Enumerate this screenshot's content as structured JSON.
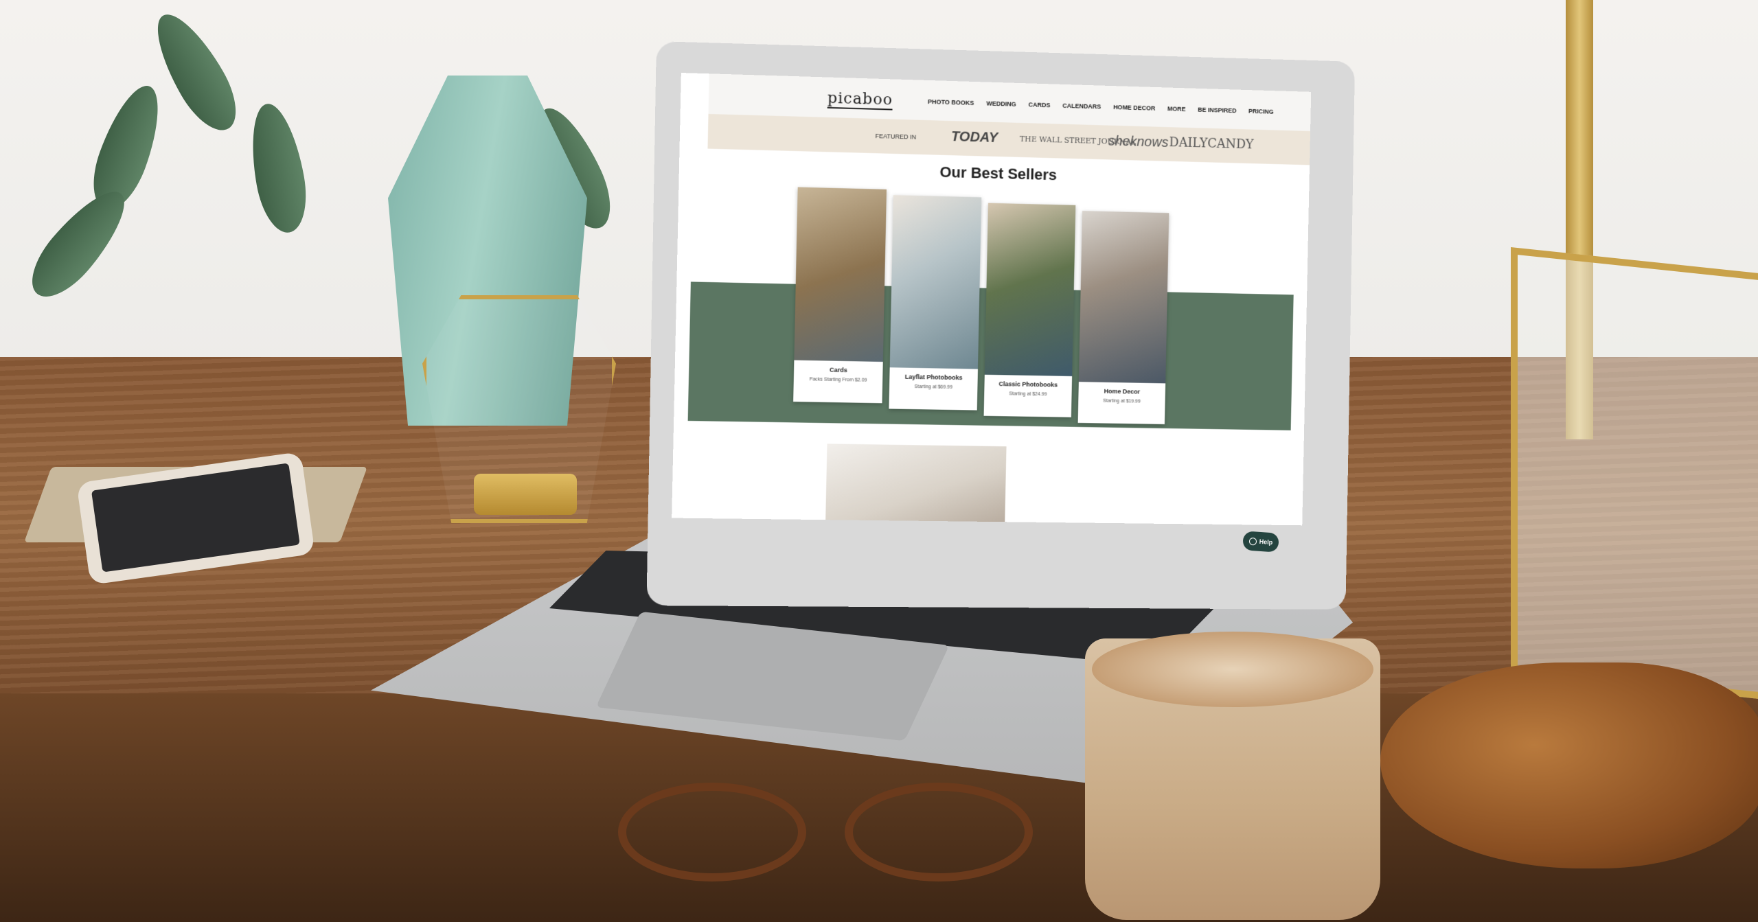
{
  "site": {
    "logo": "picaboo",
    "nav": [
      {
        "label": "PHOTO BOOKS"
      },
      {
        "label": "WEDDING"
      },
      {
        "label": "CARDS"
      },
      {
        "label": "CALENDARS"
      },
      {
        "label": "HOME DECOR"
      },
      {
        "label": "MORE"
      },
      {
        "label": "BE INSPIRED"
      },
      {
        "label": "PRICING"
      }
    ],
    "featured": {
      "label": "FEATURED IN",
      "outlets": [
        "TODAY",
        "THE WALL STREET JOURNAL",
        "sheknows",
        "DAILYCANDY"
      ]
    },
    "section_title": "Our Best Sellers",
    "products": [
      {
        "name": "Cards",
        "price": "Packs Starting From $2.09"
      },
      {
        "name": "Layflat Photobooks",
        "price": "Starting at $69.99"
      },
      {
        "name": "Classic Photobooks",
        "price": "Starting at $24.99"
      },
      {
        "name": "Home Decor",
        "price": "Starting at $19.99"
      }
    ],
    "help_label": "Help"
  },
  "colors": {
    "accent_green": "#5b7662",
    "help_button": "#24443f",
    "featured_band": "#ede5d9"
  }
}
